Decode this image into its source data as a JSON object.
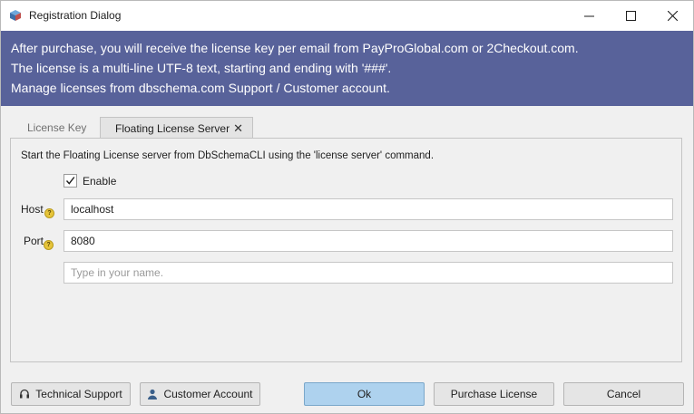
{
  "window": {
    "title": "Registration Dialog",
    "app_icon": "database-cube-icon",
    "controls": {
      "minimize_icon": "minimize-icon",
      "maximize_icon": "maximize-icon",
      "close_icon": "close-icon"
    }
  },
  "banner": {
    "background": "#58629a",
    "lines": [
      "After purchase, you will receive the license key per email from PayProGlobal.com or 2Checkout.com.",
      "The license is a multi-line UTF-8 text, starting and ending with '###'.",
      "Manage licenses from dbschema.com Support / Customer account."
    ]
  },
  "tabs": [
    {
      "label": "License Key",
      "active": false
    },
    {
      "label": "Floating License Server",
      "active": true,
      "close_glyph": "✕"
    }
  ],
  "panel": {
    "instruction": "Start the Floating License server from DbSchemaCLI using the 'license server' command.",
    "enable": {
      "label": "Enable",
      "checked": true
    },
    "host": {
      "label": "Host",
      "value": "localhost",
      "help_glyph": "?"
    },
    "port": {
      "label": "Port",
      "value": "8080",
      "help_glyph": "?"
    },
    "name": {
      "value": "",
      "placeholder": "Type in your name."
    }
  },
  "buttons": {
    "technical_support": "Technical Support",
    "customer_account": "Customer Account",
    "ok": "Ok",
    "purchase_license": "Purchase License",
    "cancel": "Cancel"
  },
  "colors": {
    "ok_button": "#aed2ee",
    "help_badge": "#e6c43a"
  }
}
